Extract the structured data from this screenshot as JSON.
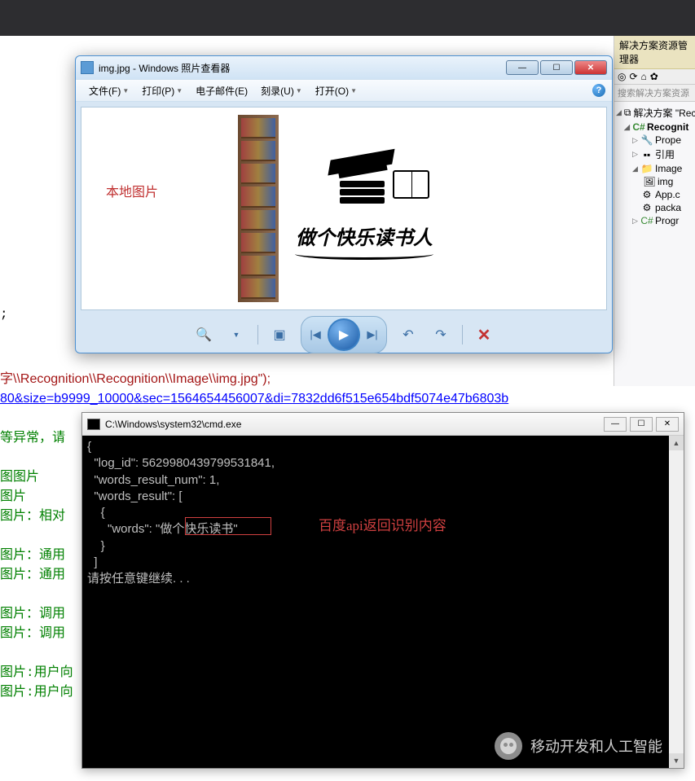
{
  "solution_explorer": {
    "title": "解决方案资源管理器",
    "search_placeholder": "搜索解决方案资源",
    "tree": {
      "solution": "解决方案 \"Rec",
      "project": "Recognit",
      "prop": "Prope",
      "refs": "引用",
      "image_folder": "Image",
      "img_file": "img",
      "app_c": "App.c",
      "packa": "packa",
      "progr": "Progr"
    }
  },
  "code": {
    "semicolon": ";",
    "path_line": "字\\\\Recognition\\\\Recognition\\\\Image\\\\img.jpg\");",
    "url_line": "80&size=b9999_10000&sec=1564654456007&di=7832dd6f515e654bdf5074e47b6803b",
    "l_err": "等异常，请",
    "l_img1": "图图片",
    "l_img2": "图片",
    "l_rel": "图片：相对",
    "l_gen1": "图片：通用",
    "l_gen2": "图片：通用",
    "l_call1": "图片：调用",
    "l_call2": "图片：调用",
    "l_user1": "图片:用户向",
    "l_user2": "图片:用户向"
  },
  "viewer": {
    "title": "img.jpg - Windows 照片查看器",
    "menu": {
      "file": "文件(F)",
      "print": "打印(P)",
      "email": "电子邮件(E)",
      "burn": "刻录(U)",
      "open": "打开(O)"
    },
    "annotation": "本地图片",
    "image_text": "做个快乐读书人"
  },
  "cmd": {
    "title": "C:\\Windows\\system32\\cmd.exe",
    "lines": {
      "l0": "{",
      "l1": "  \"log_id\": 5629980439799531841,",
      "l2": "  \"words_result_num\": 1,",
      "l3": "  \"words_result\": [",
      "l4": "    {",
      "l5_pre": "      \"words\": \"",
      "l5_val": "做个快乐读书",
      "l5_post": "\"",
      "l6": "    }",
      "l7": "  ]",
      "l8": "请按任意键继续. . ."
    },
    "annotation": "百度api返回识别内容"
  },
  "watermark": "移动开发和人工智能"
}
